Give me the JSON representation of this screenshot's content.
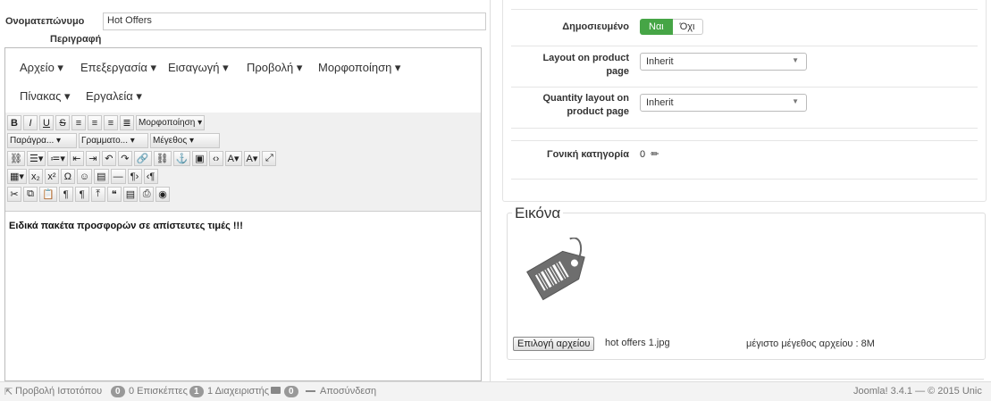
{
  "left": {
    "name_label": "Ονοματεπώνυμο",
    "name_value": "Hot Offers",
    "desc_label": "Περιγραφή",
    "menus": [
      "Αρχείο ▾",
      "Επεξεργασία ▾",
      "Εισαγωγή ▾",
      "Προβολή ▾",
      "Μορφοποίηση ▾",
      "Πίνακας ▾",
      "Εργαλεία ▾"
    ],
    "toolbar": {
      "bold": "B",
      "italic": "I",
      "underline": "U",
      "strike": "S",
      "format_dropdown": "Μορφοποίηση ▾",
      "paragraph": "Παράγρα... ▾",
      "font": "Γραμματο... ▾",
      "size": "Μέγεθος ▾"
    },
    "content_text": "Ειδικά πακέτα προσφορών σε απίστευτες τιμές !!!"
  },
  "right": {
    "published_label": "Δημοσιευμένο",
    "yes": "Ναι",
    "no": "Όχι",
    "layout_label_1": "Layout on product",
    "layout_label_2": "page",
    "layout_value": "Inherit",
    "qty_label_1": "Quantity layout on",
    "qty_label_2": "product page",
    "qty_value": "Inherit",
    "parent_label": "Γονική κατηγορία",
    "parent_value": "0",
    "image_legend": "Εικόνα",
    "choose_file": "Επιλογή αρχείου",
    "file_name": "hot offers 1.jpg",
    "max_size": "μέγιστο μέγεθος αρχείου : 8M"
  },
  "footer": {
    "view_site": "Προβολή Ιστοτόπου",
    "visitors_count": "0",
    "visitors_text": "0 Επισκέπτες",
    "admins_count": "1",
    "admins_text": "1 Διαχειριστής",
    "messages_count": "0",
    "logout": "Αποσύνδεση",
    "version": "Joomla! 3.4.1 — © 2015 Unic"
  },
  "colors": {
    "accent_green": "#46a546",
    "footer_bg": "#f3f3f3"
  }
}
